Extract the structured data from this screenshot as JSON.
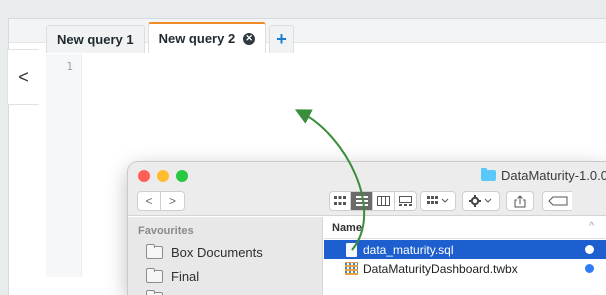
{
  "editor": {
    "tabs": [
      {
        "label": "New query 1",
        "active": false
      },
      {
        "label": "New query 2",
        "active": true
      }
    ],
    "add_tab_label": "+",
    "close_tab_glyph": "✕",
    "collapse_glyph": "<",
    "line_number": "1",
    "accent_color": "#f08c2a"
  },
  "finder": {
    "title": "DataMaturity-1.0.0",
    "nav": {
      "back": "<",
      "forward": ">"
    },
    "sidebar": {
      "heading": "Favourites",
      "items": [
        {
          "label": "Box Documents",
          "icon": "folder-icon"
        },
        {
          "label": "Final",
          "icon": "folder-icon"
        }
      ]
    },
    "column_header": "Name",
    "sort_glyph": "^",
    "files": [
      {
        "name": "data_maturity.sql",
        "selected": true,
        "icon": "document-icon"
      },
      {
        "name": "DataMaturityDashboard.twbx",
        "selected": false,
        "icon": "tableau-workbook-icon"
      }
    ],
    "selection_color": "#1e5fcf"
  },
  "annotation": {
    "arrow_color": "#3a8d3a"
  }
}
